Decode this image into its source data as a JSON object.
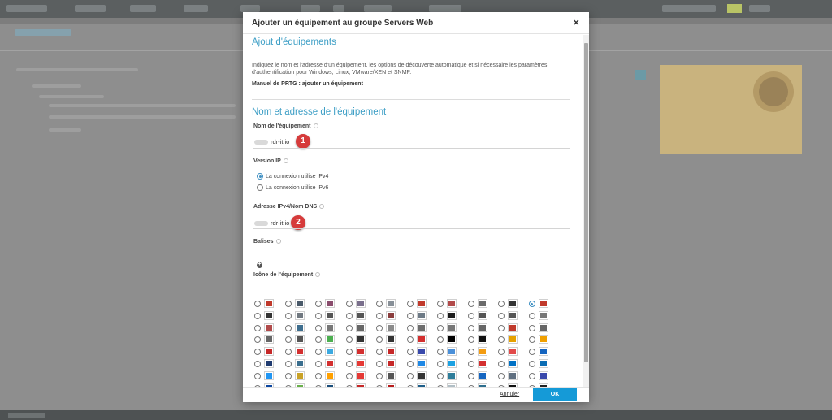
{
  "dialog": {
    "title": "Ajouter un équipement au groupe Servers Web",
    "close_symbol": "×"
  },
  "intro": {
    "heading": "Ajout d'équipements",
    "description": "Indiquez le nom et l'adresse d'un équipement, les options de découverte automatique et si nécessaire les paramètres d'authentification pour Windows, Linux, VMware/XEN et SNMP.",
    "manual_link": "Manuel de PRTG : ajouter un équipement"
  },
  "device_section": {
    "heading": "Nom et adresse de l'équipement",
    "name_label": "Nom de l'équipement",
    "name_value": "rdr-it.io",
    "name_marker": "1",
    "ip_version_label": "Version IP",
    "ip_options": [
      {
        "label": "La connexion utilise IPv4",
        "selected": true
      },
      {
        "label": "La connexion utilise IPv6",
        "selected": false
      }
    ],
    "address_label": "Adresse IPv4/Nom DNS",
    "address_value": "rdr-it.io",
    "address_marker": "2",
    "tags_label": "Balises",
    "icon_label": "Icône de l'équipement"
  },
  "icons": {
    "selected_index": 9,
    "cells": [
      [
        "#c0392b",
        "#4a5a6a",
        "#8a4c6d",
        "#7a6f8c",
        "#889098",
        "#c0392b",
        "#b14a4a",
        "#6a6a6a",
        "#333333",
        "#c0392b"
      ],
      [
        "#333333",
        "#707880",
        "#555555",
        "#555555",
        "#8a3d3d",
        "#6d7a86",
        "#1b1b1b",
        "#555555",
        "#555555",
        "#777777"
      ],
      [
        "#b14a4a",
        "#3e6e8e",
        "#777777",
        "#666666",
        "#8a8a8a",
        "#6d6d6d",
        "#777777",
        "#666666",
        "#c0392b",
        "#666666"
      ],
      [
        "#666666",
        "#555555",
        "#4caf50",
        "#333333",
        "#333333",
        "#d32f2f",
        "#000000",
        "#111111",
        "#e6a100",
        "#f0a000"
      ],
      [
        "#c62828",
        "#d32f2f",
        "#3ba9e0",
        "#d32f2f",
        "#c62828",
        "#3949ab",
        "#4a90d9",
        "#f39c12",
        "#e24a4a",
        "#1565c0"
      ],
      [
        "#1f3b70",
        "#3a6e8e",
        "#d32f2f",
        "#e53935",
        "#c62828",
        "#1e88e5",
        "#1ba1e2",
        "#d32f2f",
        "#0071c5",
        "#0a6cb3"
      ],
      [
        "#2196f3",
        "#c9a227",
        "#ffa000",
        "#e53935",
        "#555555",
        "#333333",
        "#2e7d9a",
        "#1565c0",
        "#5f6f80",
        "#3949ab"
      ],
      [
        "#0d47a1",
        "#6ab04c",
        "#1a4d7a",
        "#c62828",
        "#b71c1c",
        "#1e5f8a",
        "#b0bec5",
        "#2e6e8e",
        "#111111",
        "#222222"
      ],
      [
        "#1428a0",
        "#333333",
        "#555555",
        "#1565c0",
        "#455a64",
        "#555555",
        "#b71c1c",
        "#1a4a7a",
        "#c62828",
        "#ffffff"
      ]
    ]
  },
  "footer": {
    "cancel_label": "Annuler",
    "ok_label": "OK"
  },
  "colors": {
    "accent": "#3e9fc6",
    "ok_button": "#159ad7",
    "marker": "#d63b3b"
  }
}
